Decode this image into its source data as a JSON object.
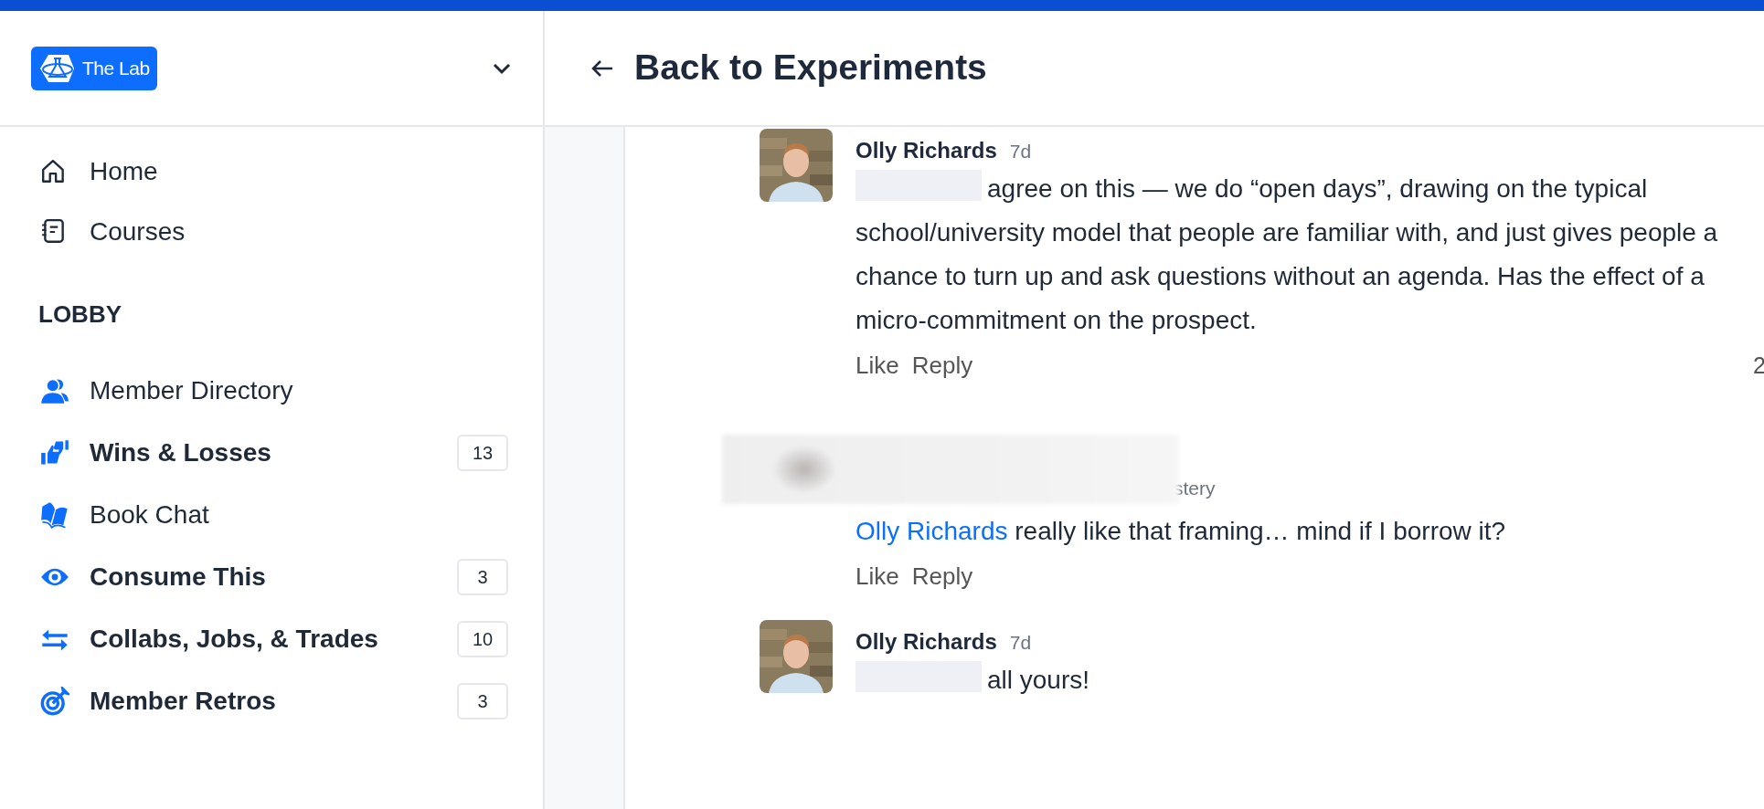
{
  "sidebar": {
    "logo_text": "The Lab",
    "nav": [
      {
        "label": "Home"
      },
      {
        "label": "Courses"
      }
    ],
    "section_title": "LOBBY",
    "channels": [
      {
        "label": "Member Directory",
        "unread": false
      },
      {
        "label": "Wins & Losses",
        "unread": true,
        "count": "13"
      },
      {
        "label": "Book Chat",
        "unread": false
      },
      {
        "label": "Consume This",
        "unread": true,
        "count": "3"
      },
      {
        "label": "Collabs, Jobs, & Trades",
        "unread": true,
        "count": "10"
      },
      {
        "label": "Member Retros",
        "unread": true,
        "count": "3"
      }
    ]
  },
  "header": {
    "back_label": "Back to Experiments"
  },
  "comments": [
    {
      "kind": "comment",
      "author": "Olly Richards",
      "time": "7d",
      "mention_hidden": true,
      "text": "agree on this — we do “open days”, drawing on the typical school/university model that people are familiar with, and just gives people a chance to turn up and ask questions without an agenda. Has the effect of a micro-commitment on the prospect.",
      "actions": [
        "Like",
        "Reply"
      ],
      "reply_count": "2"
    },
    {
      "kind": "redacted",
      "header_fragment": "stery",
      "mention": "Olly Richards",
      "text": "really like that framing… mind if I borrow it?",
      "actions": [
        "Like",
        "Reply"
      ]
    },
    {
      "kind": "comment",
      "author": "Olly Richards",
      "time": "7d",
      "mention_hidden": true,
      "text": "all yours!"
    }
  ]
}
